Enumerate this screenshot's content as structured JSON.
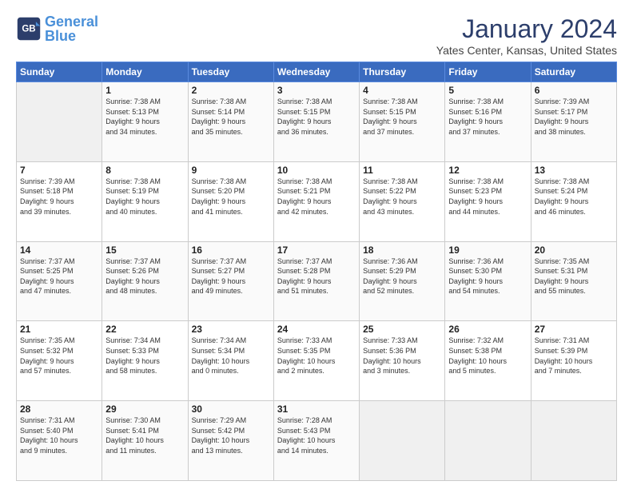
{
  "header": {
    "logo_line1": "General",
    "logo_line2": "Blue",
    "month": "January 2024",
    "location": "Yates Center, Kansas, United States"
  },
  "days_of_week": [
    "Sunday",
    "Monday",
    "Tuesday",
    "Wednesday",
    "Thursday",
    "Friday",
    "Saturday"
  ],
  "weeks": [
    [
      {
        "day": "",
        "info": ""
      },
      {
        "day": "1",
        "info": "Sunrise: 7:38 AM\nSunset: 5:13 PM\nDaylight: 9 hours\nand 34 minutes."
      },
      {
        "day": "2",
        "info": "Sunrise: 7:38 AM\nSunset: 5:14 PM\nDaylight: 9 hours\nand 35 minutes."
      },
      {
        "day": "3",
        "info": "Sunrise: 7:38 AM\nSunset: 5:15 PM\nDaylight: 9 hours\nand 36 minutes."
      },
      {
        "day": "4",
        "info": "Sunrise: 7:38 AM\nSunset: 5:15 PM\nDaylight: 9 hours\nand 37 minutes."
      },
      {
        "day": "5",
        "info": "Sunrise: 7:38 AM\nSunset: 5:16 PM\nDaylight: 9 hours\nand 37 minutes."
      },
      {
        "day": "6",
        "info": "Sunrise: 7:39 AM\nSunset: 5:17 PM\nDaylight: 9 hours\nand 38 minutes."
      }
    ],
    [
      {
        "day": "7",
        "info": "Sunrise: 7:39 AM\nSunset: 5:18 PM\nDaylight: 9 hours\nand 39 minutes."
      },
      {
        "day": "8",
        "info": "Sunrise: 7:38 AM\nSunset: 5:19 PM\nDaylight: 9 hours\nand 40 minutes."
      },
      {
        "day": "9",
        "info": "Sunrise: 7:38 AM\nSunset: 5:20 PM\nDaylight: 9 hours\nand 41 minutes."
      },
      {
        "day": "10",
        "info": "Sunrise: 7:38 AM\nSunset: 5:21 PM\nDaylight: 9 hours\nand 42 minutes."
      },
      {
        "day": "11",
        "info": "Sunrise: 7:38 AM\nSunset: 5:22 PM\nDaylight: 9 hours\nand 43 minutes."
      },
      {
        "day": "12",
        "info": "Sunrise: 7:38 AM\nSunset: 5:23 PM\nDaylight: 9 hours\nand 44 minutes."
      },
      {
        "day": "13",
        "info": "Sunrise: 7:38 AM\nSunset: 5:24 PM\nDaylight: 9 hours\nand 46 minutes."
      }
    ],
    [
      {
        "day": "14",
        "info": "Sunrise: 7:37 AM\nSunset: 5:25 PM\nDaylight: 9 hours\nand 47 minutes."
      },
      {
        "day": "15",
        "info": "Sunrise: 7:37 AM\nSunset: 5:26 PM\nDaylight: 9 hours\nand 48 minutes."
      },
      {
        "day": "16",
        "info": "Sunrise: 7:37 AM\nSunset: 5:27 PM\nDaylight: 9 hours\nand 49 minutes."
      },
      {
        "day": "17",
        "info": "Sunrise: 7:37 AM\nSunset: 5:28 PM\nDaylight: 9 hours\nand 51 minutes."
      },
      {
        "day": "18",
        "info": "Sunrise: 7:36 AM\nSunset: 5:29 PM\nDaylight: 9 hours\nand 52 minutes."
      },
      {
        "day": "19",
        "info": "Sunrise: 7:36 AM\nSunset: 5:30 PM\nDaylight: 9 hours\nand 54 minutes."
      },
      {
        "day": "20",
        "info": "Sunrise: 7:35 AM\nSunset: 5:31 PM\nDaylight: 9 hours\nand 55 minutes."
      }
    ],
    [
      {
        "day": "21",
        "info": "Sunrise: 7:35 AM\nSunset: 5:32 PM\nDaylight: 9 hours\nand 57 minutes."
      },
      {
        "day": "22",
        "info": "Sunrise: 7:34 AM\nSunset: 5:33 PM\nDaylight: 9 hours\nand 58 minutes."
      },
      {
        "day": "23",
        "info": "Sunrise: 7:34 AM\nSunset: 5:34 PM\nDaylight: 10 hours\nand 0 minutes."
      },
      {
        "day": "24",
        "info": "Sunrise: 7:33 AM\nSunset: 5:35 PM\nDaylight: 10 hours\nand 2 minutes."
      },
      {
        "day": "25",
        "info": "Sunrise: 7:33 AM\nSunset: 5:36 PM\nDaylight: 10 hours\nand 3 minutes."
      },
      {
        "day": "26",
        "info": "Sunrise: 7:32 AM\nSunset: 5:38 PM\nDaylight: 10 hours\nand 5 minutes."
      },
      {
        "day": "27",
        "info": "Sunrise: 7:31 AM\nSunset: 5:39 PM\nDaylight: 10 hours\nand 7 minutes."
      }
    ],
    [
      {
        "day": "28",
        "info": "Sunrise: 7:31 AM\nSunset: 5:40 PM\nDaylight: 10 hours\nand 9 minutes."
      },
      {
        "day": "29",
        "info": "Sunrise: 7:30 AM\nSunset: 5:41 PM\nDaylight: 10 hours\nand 11 minutes."
      },
      {
        "day": "30",
        "info": "Sunrise: 7:29 AM\nSunset: 5:42 PM\nDaylight: 10 hours\nand 13 minutes."
      },
      {
        "day": "31",
        "info": "Sunrise: 7:28 AM\nSunset: 5:43 PM\nDaylight: 10 hours\nand 14 minutes."
      },
      {
        "day": "",
        "info": ""
      },
      {
        "day": "",
        "info": ""
      },
      {
        "day": "",
        "info": ""
      }
    ]
  ]
}
